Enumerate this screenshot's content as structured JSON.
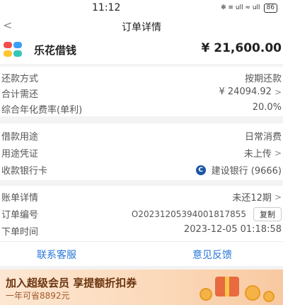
{
  "status_bar": {
    "time": "11:12",
    "icons_text": "✻ ≋ ull ≈ ull",
    "battery": "86"
  },
  "nav": {
    "back": "<",
    "title": "订单详情"
  },
  "header": {
    "brand": "乐花借钱",
    "amount": "¥ 21,600.00"
  },
  "repayment": {
    "rows": [
      {
        "label": "还款方式",
        "value": "按期还款"
      },
      {
        "label": "合计需还",
        "value": "¥ 24094.92"
      },
      {
        "label": "综合年化费率(单利)",
        "value": "20.0%"
      }
    ]
  },
  "loan": {
    "rows": [
      {
        "label": "借款用途",
        "value": "日常消费"
      },
      {
        "label": "用途凭证",
        "value": "未上传"
      },
      {
        "label": "收款银行卡",
        "bank_icon": "C",
        "value": "建设银行 (9666)"
      }
    ]
  },
  "order": {
    "bill_label": "账单详情",
    "bill_value": "未还12期",
    "order_no_label": "订单编号",
    "order_no": "O20231205394001817855",
    "copy_label": "复制",
    "time_label": "下单时间",
    "time_value": "2023-12-05 01:18:58"
  },
  "actions": {
    "contact": "联系客服",
    "feedback": "意见反馈"
  },
  "banner": {
    "title": "加入超级会员 享提额折扣券",
    "subtitle": "一年可省8892元"
  }
}
